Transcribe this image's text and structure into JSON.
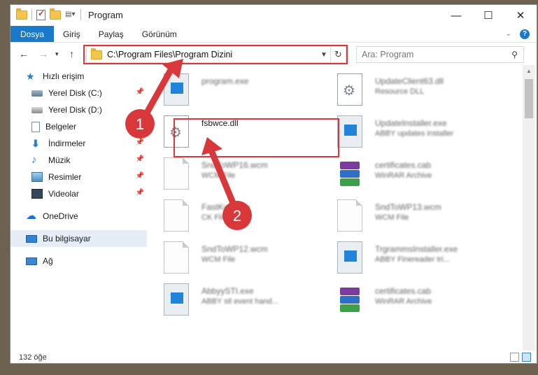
{
  "window": {
    "title": "Program",
    "controls": {
      "minimize": "—",
      "maximize": "☐",
      "close": "✕"
    }
  },
  "ribbon": {
    "tabs": [
      {
        "label": "Dosya",
        "active": true
      },
      {
        "label": "Giriş"
      },
      {
        "label": "Paylaş"
      },
      {
        "label": "Görünüm"
      }
    ],
    "expand_icon": "chevron-down-icon",
    "help_icon": "?"
  },
  "address": {
    "path": "C:\\Program Files\\Program Dizini",
    "refresh_icon": "↻"
  },
  "search": {
    "placeholder": "Ara: Program"
  },
  "nav": {
    "items": [
      {
        "label": "Hızlı erişim",
        "icon": "star-icon"
      },
      {
        "label": "Yerel Disk (C:)",
        "icon": "disk-icon",
        "pinned": true
      },
      {
        "label": "Yerel Disk (D:)",
        "icon": "disk-icon"
      },
      {
        "label": "Belgeler",
        "icon": "documents-icon",
        "pinned": true
      },
      {
        "label": "İndirmeler",
        "icon": "download-icon",
        "pinned": true
      },
      {
        "label": "Müzik",
        "icon": "music-icon",
        "pinned": true
      },
      {
        "label": "Resimler",
        "icon": "pictures-icon",
        "pinned": true
      },
      {
        "label": "Videolar",
        "icon": "videos-icon",
        "pinned": true
      },
      {
        "label": "OneDrive",
        "icon": "cloud-icon"
      },
      {
        "label": "Bu bilgisayar",
        "icon": "computer-icon",
        "selected": true
      },
      {
        "label": "Ağ",
        "icon": "network-icon"
      }
    ]
  },
  "files": [
    {
      "name": "program.exe",
      "sub": "",
      "icon": "app-icon",
      "blurred": true
    },
    {
      "name": "UpdateClient63.dll",
      "sub": "Resource DLL",
      "icon": "dll-icon",
      "blurred": true
    },
    {
      "name": "fsbwce.dll",
      "sub": "",
      "icon": "dll-icon",
      "blurred": false
    },
    {
      "name": "UpdateInstaller.exe",
      "sub": "ABBY updates installer",
      "icon": "app-icon",
      "blurred": true
    },
    {
      "name": "SndToWP16.wcm",
      "sub": "WCM File",
      "icon": "file-icon",
      "blurred": true
    },
    {
      "name": "certificates.cab",
      "sub": "WinRAR Archive",
      "icon": "archive-icon",
      "blurred": true
    },
    {
      "name": "FastKonv.cfg",
      "sub": "CK File",
      "icon": "file-icon",
      "blurred": true
    },
    {
      "name": "SndToWP13.wcm",
      "sub": "WCM File",
      "icon": "file-icon",
      "blurred": true
    },
    {
      "name": "SndToWP12.wcm",
      "sub": "WCM File",
      "icon": "file-icon",
      "blurred": true
    },
    {
      "name": "TrgrammsInstaller.exe",
      "sub": "ABBY Finereader tri...",
      "icon": "app-icon",
      "blurred": true
    },
    {
      "name": "AbbyySTI.exe",
      "sub": "ABBY stl event hand...",
      "icon": "app-icon",
      "blurred": true
    },
    {
      "name": "certificates.cab",
      "sub": "WinRAR Archive",
      "icon": "archive-icon",
      "blurred": true
    }
  ],
  "annotations": {
    "step1": "1",
    "step2": "2",
    "color": "#d9383a"
  },
  "status": {
    "count": "132 öğe"
  }
}
